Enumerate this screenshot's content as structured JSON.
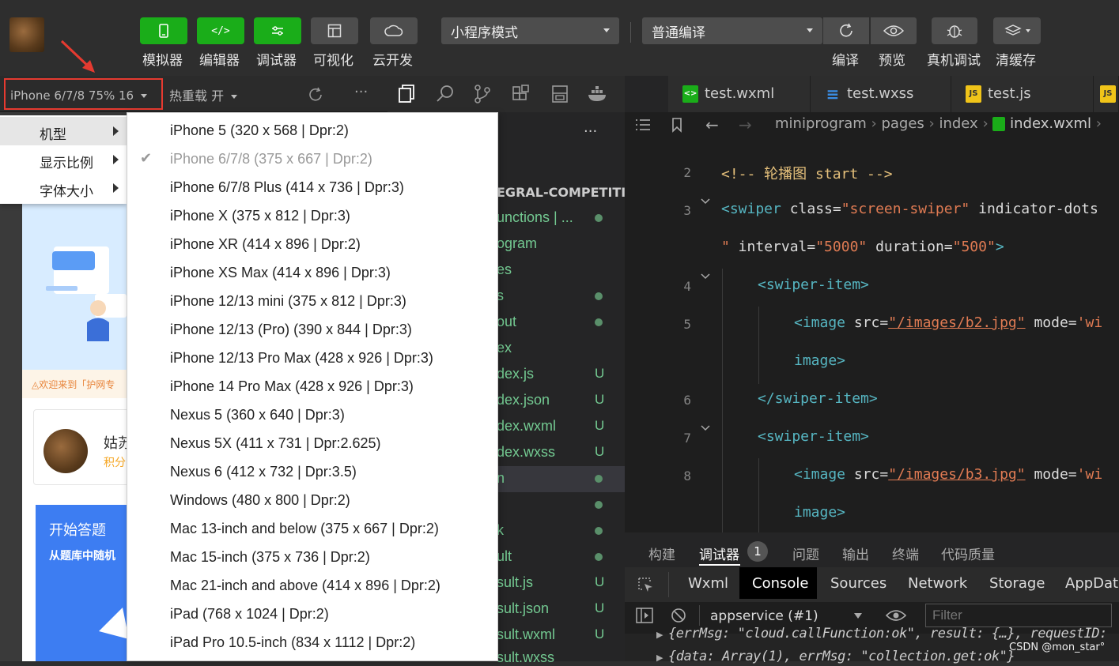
{
  "toolbar": {
    "buttons": [
      {
        "label": "模拟器",
        "icon": "phone-icon"
      },
      {
        "label": "编辑器",
        "icon": "code-icon"
      },
      {
        "label": "调试器",
        "icon": "debug-icon"
      },
      {
        "label": "可视化",
        "icon": "layout-icon"
      },
      {
        "label": "云开发",
        "icon": "cloud-icon"
      }
    ],
    "mode_select": "小程序模式",
    "compile_select": "普通编译",
    "right_buttons": [
      {
        "label": "编译",
        "icon": "refresh-icon"
      },
      {
        "label": "预览",
        "icon": "eye-icon"
      },
      {
        "label": "真机调试",
        "icon": "bug-icon"
      },
      {
        "label": "清缓存",
        "icon": "layers-icon"
      }
    ]
  },
  "simulator": {
    "device_label": "iPhone 6/7/8 75% 16",
    "hot_reload": "热重载 开",
    "more": "···"
  },
  "context_menu": [
    {
      "label": "机型",
      "active": true
    },
    {
      "label": "显示比例",
      "active": false
    },
    {
      "label": "字体大小",
      "active": false
    }
  ],
  "device_list": [
    {
      "name": "iPhone 5",
      "spec": "(320 x 568 | Dpr:2)",
      "checked": false
    },
    {
      "name": "iPhone 6/7/8",
      "spec": "(375 x 667 | Dpr:2)",
      "checked": true
    },
    {
      "name": "iPhone 6/7/8 Plus",
      "spec": "(414 x 736 | Dpr:3)",
      "checked": false
    },
    {
      "name": "iPhone X",
      "spec": "(375 x 812 | Dpr:3)",
      "checked": false
    },
    {
      "name": "iPhone XR",
      "spec": "(414 x 896 | Dpr:2)",
      "checked": false
    },
    {
      "name": "iPhone XS Max",
      "spec": "(414 x 896 | Dpr:3)",
      "checked": false
    },
    {
      "name": "iPhone 12/13 mini",
      "spec": "(375 x 812 | Dpr:3)",
      "checked": false
    },
    {
      "name": "iPhone 12/13 (Pro)",
      "spec": "(390 x 844 | Dpr:3)",
      "checked": false
    },
    {
      "name": "iPhone 12/13 Pro Max",
      "spec": "(428 x 926 | Dpr:3)",
      "checked": false
    },
    {
      "name": "iPhone 14 Pro Max",
      "spec": "(428 x 926 | Dpr:3)",
      "checked": false
    },
    {
      "name": "Nexus 5",
      "spec": "(360 x 640 | Dpr:3)",
      "checked": false
    },
    {
      "name": "Nexus 5X",
      "spec": "(411 x 731 | Dpr:2.625)",
      "checked": false
    },
    {
      "name": "Nexus 6",
      "spec": "(412 x 732 | Dpr:3.5)",
      "checked": false
    },
    {
      "name": "Windows",
      "spec": "(480 x 800 | Dpr:2)",
      "checked": false
    },
    {
      "name": "Mac 13-inch and below",
      "spec": "(375 x 667 | Dpr:2)",
      "checked": false
    },
    {
      "name": "Mac 15-inch",
      "spec": "(375 x 736 | Dpr:2)",
      "checked": false
    },
    {
      "name": "Mac 21-inch and above",
      "spec": "(414 x 896 | Dpr:2)",
      "checked": false
    },
    {
      "name": "iPad",
      "spec": "(768 x 1024 | Dpr:2)",
      "checked": false
    },
    {
      "name": "iPad Pro 10.5-inch",
      "spec": "(834 x 1112 | Dpr:2)",
      "checked": false
    }
  ],
  "phone_preview": {
    "banner_text": "◬欢迎来到「护网专",
    "user_name": "姑苏",
    "user_points": "积分",
    "card_title": "开始答题",
    "card_subtitle": "从题库中随机"
  },
  "explorer": {
    "more": "···",
    "project": "EGRAL-COMPETITI...",
    "items": [
      {
        "label": "unctions | ...",
        "status": "dot"
      },
      {
        "label": "ogram",
        "status": ""
      },
      {
        "label": "es",
        "status": ""
      },
      {
        "label": "s",
        "status": "dot"
      },
      {
        "label": "out",
        "status": "dot"
      },
      {
        "label": "ex",
        "status": ""
      },
      {
        "label": "dex.js",
        "status": "U"
      },
      {
        "label": "dex.json",
        "status": "U"
      },
      {
        "label": "dex.wxml",
        "status": "U"
      },
      {
        "label": "dex.wxss",
        "status": "U"
      },
      {
        "label": "n",
        "status": "dot"
      },
      {
        "label": "",
        "status": "dot"
      },
      {
        "label": "k",
        "status": "dot"
      },
      {
        "label": "ult",
        "status": "dot"
      },
      {
        "label": "sult.js",
        "status": "U"
      },
      {
        "label": "sult.json",
        "status": "U"
      },
      {
        "label": "sult.wxml",
        "status": "U"
      },
      {
        "label": "sult.wxss",
        "status": "U"
      }
    ]
  },
  "editor": {
    "tabs": [
      {
        "label": "test.wxml",
        "icon": "<>",
        "color": "#1aad19"
      },
      {
        "label": "test.wxss",
        "icon": "≡",
        "color": "#3a8ee6"
      },
      {
        "label": "test.js",
        "icon": "JS",
        "color": "#f0c419"
      }
    ],
    "breadcrumb": [
      "miniprogram",
      "pages",
      "index",
      "index.wxml"
    ],
    "lines": [
      {
        "n": "2",
        "parts": [
          [
            "c-cm",
            "<!-- 轮播图 start -->"
          ]
        ]
      },
      {
        "n": "3",
        "parts": [
          [
            "c-tag",
            "<swiper"
          ],
          [
            "c-attr",
            " class="
          ],
          [
            "c-str",
            "\"screen-swiper\""
          ],
          [
            "c-attr",
            " indicator-dots"
          ]
        ]
      },
      {
        "n": "",
        "parts": [
          [
            "c-str",
            "\""
          ],
          [
            "c-attr",
            " interval="
          ],
          [
            "c-str",
            "\"5000\""
          ],
          [
            "c-attr",
            " duration="
          ],
          [
            "c-str",
            "\"500\""
          ],
          [
            "c-tag",
            ">"
          ]
        ]
      },
      {
        "n": "4",
        "parts": [
          [
            "c-tag",
            "<swiper-item>"
          ]
        ]
      },
      {
        "n": "5",
        "parts": [
          [
            "c-tag",
            "<image"
          ],
          [
            "c-attr",
            " src="
          ],
          [
            "c-str",
            "\"/images/b2.jpg\""
          ],
          [
            "c-attr",
            " mode="
          ],
          [
            "c-str",
            "'wi"
          ]
        ]
      },
      {
        "n": "",
        "parts": [
          [
            "c-tag",
            "image>"
          ]
        ]
      },
      {
        "n": "6",
        "parts": [
          [
            "c-tag",
            "</swiper-item>"
          ]
        ]
      },
      {
        "n": "7",
        "parts": [
          [
            "c-tag",
            "<swiper-item>"
          ]
        ]
      },
      {
        "n": "8",
        "parts": [
          [
            "c-tag",
            "<image"
          ],
          [
            "c-attr",
            " src="
          ],
          [
            "c-str",
            "\"/images/b3.jpg\""
          ],
          [
            "c-attr",
            " mode="
          ],
          [
            "c-str",
            "'wi"
          ]
        ]
      },
      {
        "n": "",
        "parts": [
          [
            "c-tag",
            "image>"
          ]
        ]
      }
    ]
  },
  "bottom_panel": {
    "tabs": [
      "构建",
      "调试器",
      "问题",
      "输出",
      "终端",
      "代码质量"
    ],
    "debugger_badge": "1",
    "console_tabs": [
      "Wxml",
      "Console",
      "Sources",
      "Network",
      "Storage",
      "AppData"
    ],
    "context_select": "appservice (#1)",
    "filter_placeholder": "Filter",
    "log_lines": [
      "{errMsg: \"cloud.callFunction:ok\", result: {…}, requestID:",
      "{data: Array(1), errMsg: \"collection.get:ok\"}"
    ]
  },
  "watermark": "CSDN @mon_star°"
}
